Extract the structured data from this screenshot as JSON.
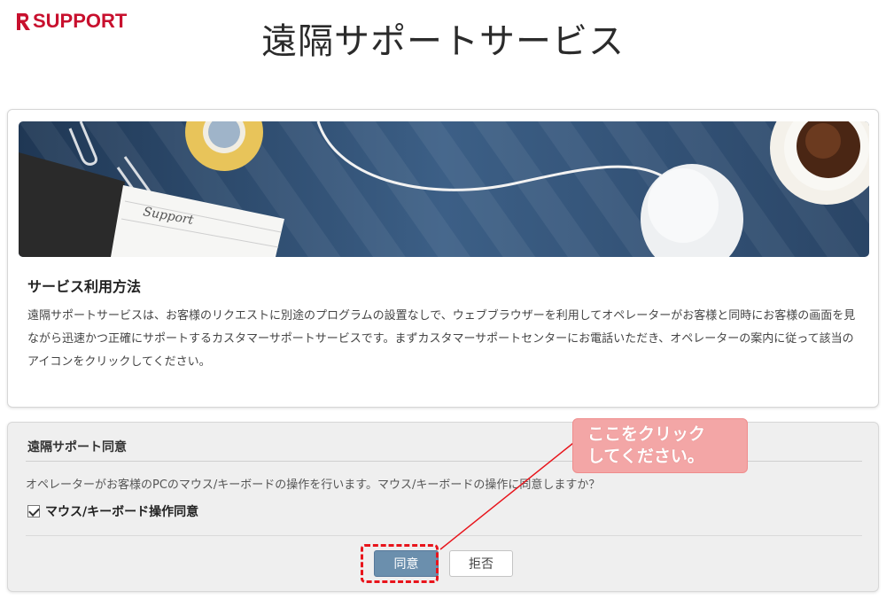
{
  "brand": {
    "logo_text": "SUPPORT",
    "logo_mark": "R",
    "accent": "#c8102e"
  },
  "page": {
    "title": "遠隔サポートサービス"
  },
  "info": {
    "section_title": "サービス利用方法",
    "description": "遠隔サポートサービスは、お客様のリクエストに別途のプログラムの設置なしで、ウェブブラウザーを利用してオペレーターがお客様と同時にお客様の画面を見ながら迅速かつ正確にサポートするカスタマーサポートサービスです。まずカスタマーサポートセンターにお電話いただき、オペレーターの案内に従って該当のアイコンをクリックしてください。",
    "banner_note": "Support"
  },
  "consent": {
    "title": "遠隔サポート同意",
    "text": "オペレーターがお客様のPCのマウス/キーボードの操作を行います。マウス/キーボードの操作に同意しますか？",
    "checkbox_label": "マウス/キーボード操作同意",
    "checkbox_checked": true,
    "agree_label": "同意",
    "decline_label": "拒否",
    "agree_color": "#6b8fad"
  },
  "callout": {
    "line1": "ここをクリック",
    "line2": "してください。",
    "color": "#f3a6a6",
    "arrow_color": "#e8141b"
  }
}
